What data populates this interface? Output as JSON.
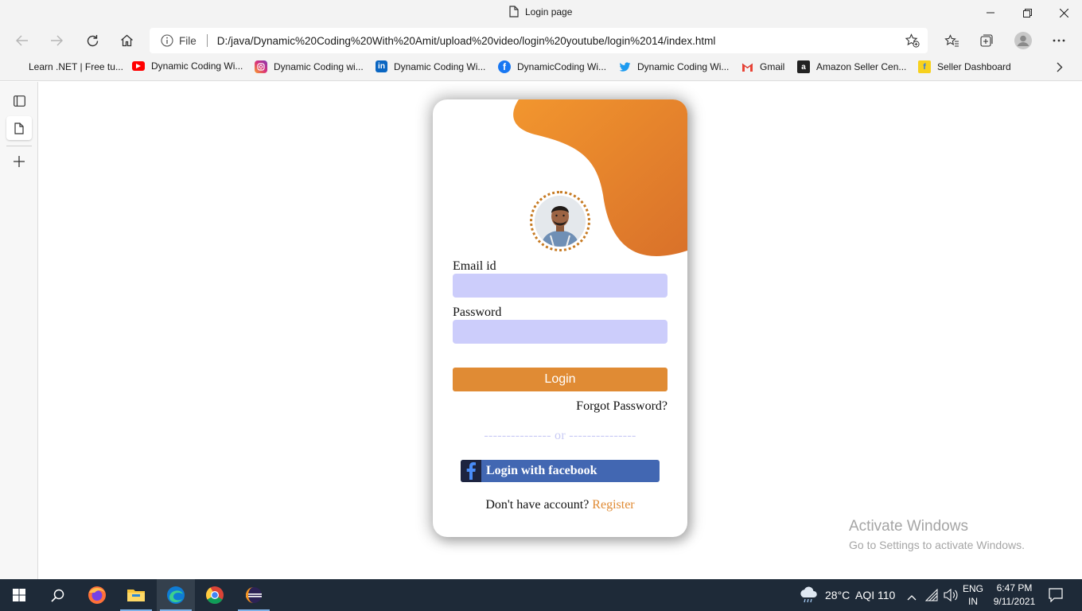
{
  "window": {
    "title": "Login page"
  },
  "browser": {
    "address_label": "File",
    "url": "D:/java/Dynamic%20Coding%20With%20Amit/upload%20video/login%20youtube/login%2014/index.html",
    "bookmarks": [
      {
        "label": "Learn .NET | Free tu...",
        "icon": "microsoft-icon"
      },
      {
        "label": "Dynamic Coding Wi...",
        "icon": "youtube-icon"
      },
      {
        "label": "Dynamic Coding wi...",
        "icon": "instagram-icon"
      },
      {
        "label": "Dynamic Coding Wi...",
        "icon": "linkedin-icon"
      },
      {
        "label": "DynamicCoding Wi...",
        "icon": "facebook-icon"
      },
      {
        "label": "Dynamic Coding Wi...",
        "icon": "twitter-icon"
      },
      {
        "label": "Gmail",
        "icon": "gmail-icon"
      },
      {
        "label": "Amazon Seller Cen...",
        "icon": "amazon-icon"
      },
      {
        "label": "Seller Dashboard",
        "icon": "flipkart-icon"
      }
    ]
  },
  "login": {
    "email_label": "Email id",
    "email_value": "",
    "password_label": "Password",
    "password_value": "",
    "login_button": "Login",
    "forgot": "Forgot Password?",
    "or_divider": "--------------- or ---------------",
    "facebook_button": "Login with facebook",
    "no_account": "Don't have account?",
    "register": "Register"
  },
  "watermark": {
    "line1": "Activate Windows",
    "line2": "Go to Settings to activate Windows."
  },
  "taskbar": {
    "weather": "28°C",
    "aqi": "AQI 110",
    "lang_top": "ENG",
    "lang_bottom": "IN",
    "time": "6:47 PM",
    "date": "9/11/2021"
  },
  "colors": {
    "accent": "#e08b34",
    "field_bg": "#cccdfb",
    "facebook": "#4267b2"
  }
}
